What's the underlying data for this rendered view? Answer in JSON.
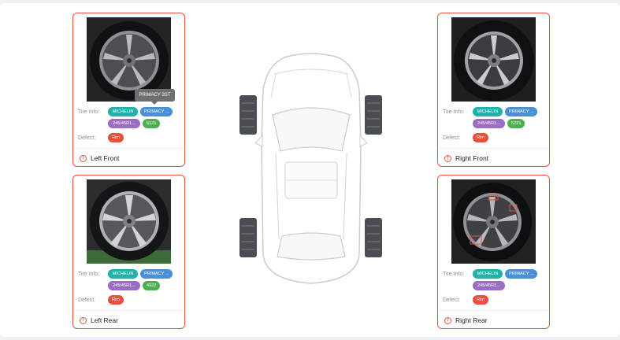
{
  "cards": [
    {
      "id": "left-front",
      "tire_label": "Tire Info:",
      "defect_label": "Defect:",
      "brand": "MICHELIN",
      "model": "PRIMACY ...",
      "size": "245/45R1...",
      "dot": "5121",
      "defect": "Rim",
      "position": "Left Front"
    },
    {
      "id": "right-front",
      "tire_label": "Tire Info:",
      "defect_label": "Defect:",
      "brand": "MICHELIN",
      "model": "PRIMACY ...",
      "size": "245/45R1...",
      "dot": "5221",
      "defect": "Rim",
      "position": "Right Front"
    },
    {
      "id": "left-rear",
      "tire_label": "Tire Info:",
      "defect_label": "Defect:",
      "brand": "MICHELIN",
      "model": "PRIMACY ...",
      "size": "245/45R1...",
      "dot": "4922",
      "defect": "Rim",
      "position": "Left Rear"
    },
    {
      "id": "right-rear",
      "tire_label": "Tire Info:",
      "defect_label": "Defect:",
      "brand": "MICHELIN",
      "model": "PRIMACY ...",
      "size": "245/45R1...",
      "defect": "Rim",
      "position": "Right Rear"
    }
  ],
  "tooltip": "PRIMACY 3ST",
  "icons": {
    "warning": "warning-circle-icon",
    "car": "car-top-view-icon"
  },
  "colors": {
    "card_border": "#e8503e",
    "brand_tag": "#20b2aa",
    "model_tag": "#4a90d9",
    "size_tag": "#9b6cc4",
    "dot_tag": "#4caf50",
    "defect_tag": "#e8503e"
  }
}
